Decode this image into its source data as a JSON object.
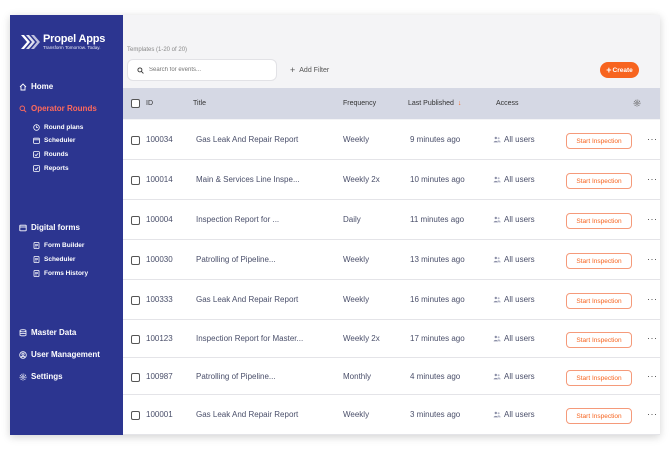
{
  "brand": {
    "name": "Propel Apps",
    "tagline": "Transform Tomorrow. Today."
  },
  "nav": {
    "home": "Home",
    "operator_rounds": "Operator Rounds",
    "rounds_sub": [
      "Round plans",
      "Scheduler",
      "Rounds",
      "Reports"
    ],
    "digital_forms": "Digital forms",
    "forms_sub": [
      "Form Builder",
      "Scheduler",
      "Forms History"
    ],
    "master_data": "Master Data",
    "user_management": "User Management",
    "settings": "Settings"
  },
  "toolbar": {
    "count": "Templates (1-20 of 20)",
    "search_placeholder": "Search for events...",
    "add_filter": "Add Filter",
    "create": "Create"
  },
  "table": {
    "columns": {
      "id": "ID",
      "title": "Title",
      "frequency": "Frequency",
      "last_published": "Last Published",
      "access": "Access"
    },
    "action_label": "Start Inspection",
    "more": "···",
    "rows": [
      {
        "id": "100034",
        "title": "Gas Leak And Repair Report",
        "frequency": "Weekly",
        "published": "9 minutes ago",
        "access": "All users"
      },
      {
        "id": "100014",
        "title": "Main & Services Line Inspe...",
        "frequency": "Weekly 2x",
        "published": "10 minutes ago",
        "access": "All users"
      },
      {
        "id": "100004",
        "title": "Inspection Report for ...",
        "frequency": "Daily",
        "published": "11 minutes ago",
        "access": "All users"
      },
      {
        "id": "100030",
        "title": "Patrolling of Pipeline...",
        "frequency": "Weekly",
        "published": "13 minutes ago",
        "access": "All users"
      },
      {
        "id": "100333",
        "title": "Gas Leak And Repair Report",
        "frequency": "Weekly",
        "published": "16 minutes ago",
        "access": "All users"
      },
      {
        "id": "100123",
        "title": "Inspection Report for Master...",
        "frequency": "Weekly 2x",
        "published": "17 minutes ago",
        "access": "All users"
      },
      {
        "id": "100987",
        "title": "Patrolling of Pipeline...",
        "frequency": "Monthly",
        "published": "4 minutes ago",
        "access": "All users"
      },
      {
        "id": "100001",
        "title": "Gas Leak And Repair Report",
        "frequency": "Weekly",
        "published": "3 minutes ago",
        "access": "All users"
      }
    ]
  },
  "colors": {
    "sidebar": "#2c3590",
    "accent": "#f7641f",
    "active_nav": "#ff6a5c",
    "header_bg": "#d5d8e4"
  }
}
